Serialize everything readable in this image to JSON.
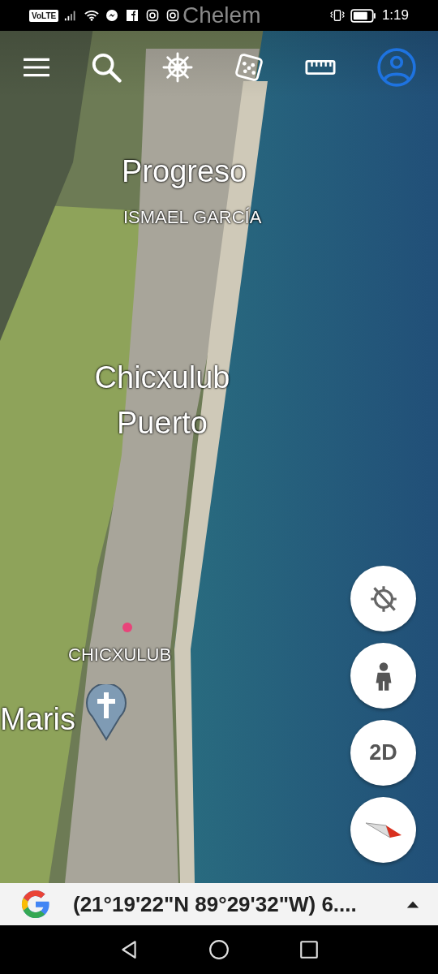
{
  "status_bar": {
    "network": "VoLTE",
    "time": "1:19"
  },
  "map_labels": [
    {
      "kind": "faint",
      "text": "Chelem"
    },
    {
      "kind": "city",
      "text": "Progreso"
    },
    {
      "kind": "district",
      "text": "ISMAEL GARCÍA"
    },
    {
      "kind": "city",
      "text": "Chicxulub Puerto"
    },
    {
      "kind": "district",
      "text": "CHICXULUB"
    },
    {
      "kind": "place",
      "text": "Maris"
    }
  ],
  "map_controls": [
    {
      "kind": "location"
    },
    {
      "kind": "street-view"
    },
    {
      "kind": "text",
      "text": "2D"
    },
    {
      "kind": "compass"
    }
  ],
  "location_bar": {
    "coordinates": "(21°19'22\"N 89°29'32\"W) 6...."
  }
}
